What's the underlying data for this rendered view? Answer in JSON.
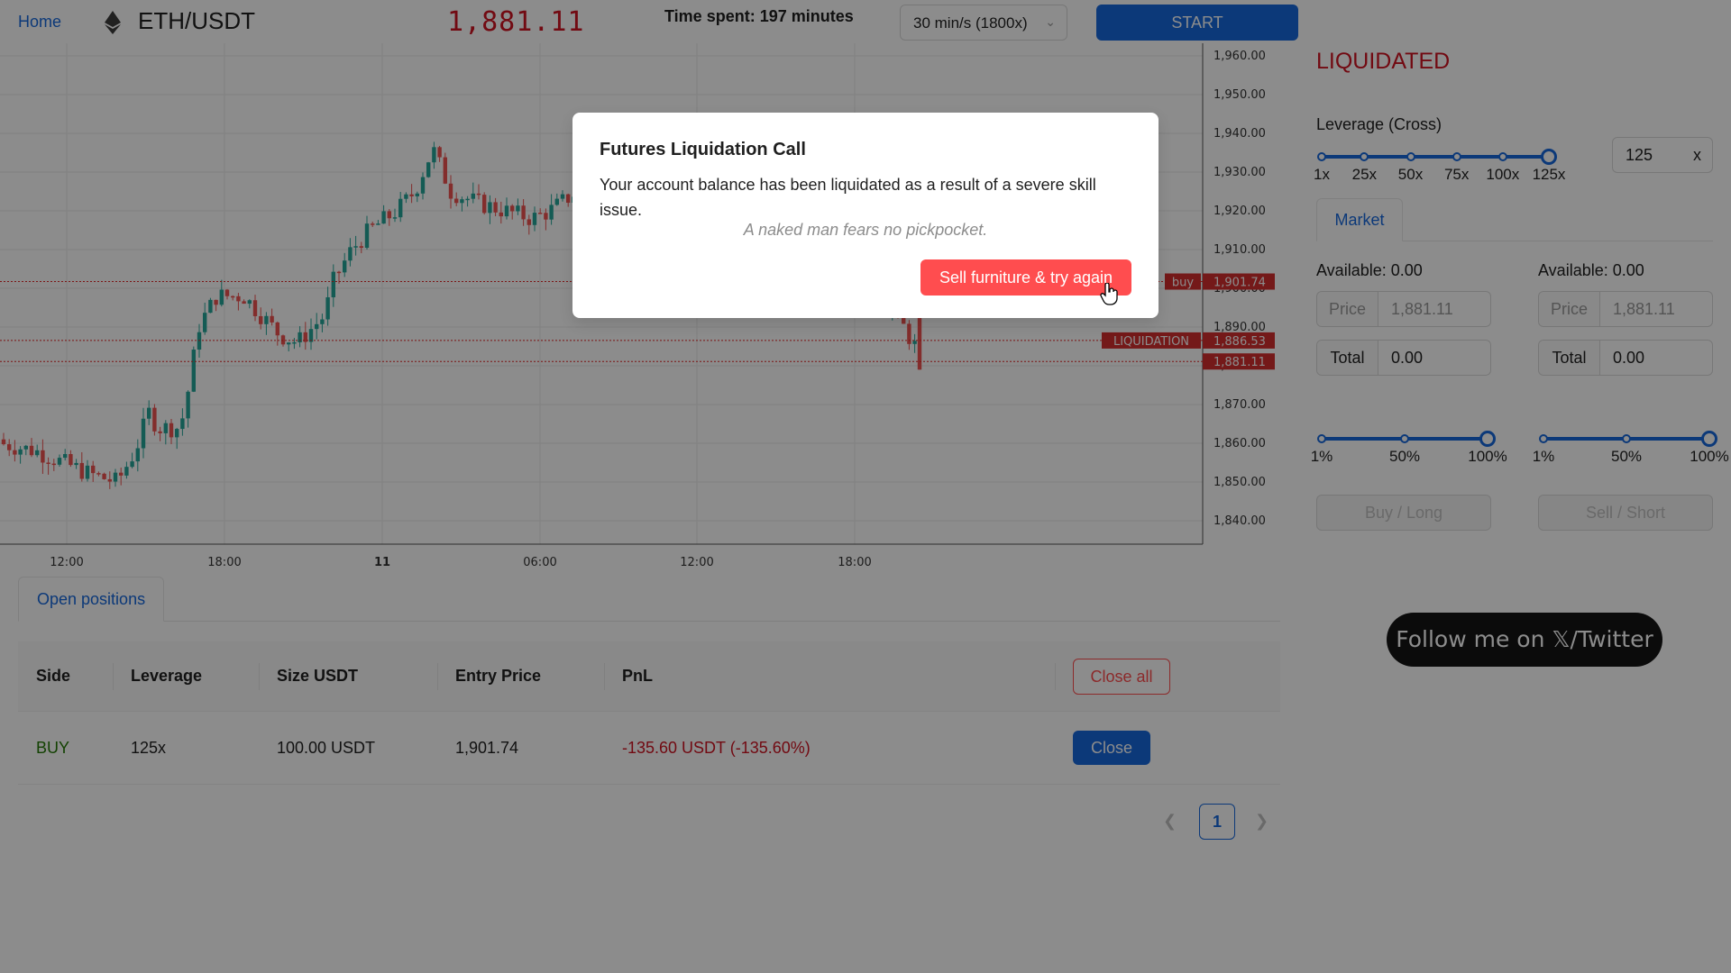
{
  "topbar": {
    "home_label": "Home",
    "pair": "ETH/USDT",
    "price": "1,881.11",
    "time_spent_label": "Time spent:",
    "time_spent_value": "197 minutes",
    "speed_select": "30 min/s (1800x)",
    "start_label": "START"
  },
  "chart_data": {
    "type": "candlestick",
    "y_ticks": [
      "1,960.00",
      "1,950.00",
      "1,940.00",
      "1,930.00",
      "1,920.00",
      "1,910.00",
      "1,900.00",
      "1,890.00",
      "1,880.00",
      "1,870.00",
      "1,860.00",
      "1,850.00",
      "1,840.00"
    ],
    "x_ticks": [
      "12:00",
      "18:00",
      "11",
      "06:00",
      "12:00",
      "18:00"
    ],
    "ylim": [
      1835,
      1962
    ],
    "price_lines": [
      {
        "label": "buy",
        "value": 1901.74,
        "value_label": "1,901.74"
      },
      {
        "label": "LIQUIDATION",
        "value": 1886.53,
        "value_label": "1,886.53"
      },
      {
        "label": "",
        "value": 1881.11,
        "value_label": "1,881.11"
      }
    ],
    "colors": {
      "up": "#26a69a",
      "down": "#ef5350",
      "grid": "#ececec",
      "line_red": "#e02424",
      "label_bg": "#d32f2f"
    }
  },
  "positions": {
    "tab_label": "Open positions",
    "headers": {
      "side": "Side",
      "leverage": "Leverage",
      "size": "Size USDT",
      "entry": "Entry Price",
      "pnl": "PnL"
    },
    "close_all_label": "Close all",
    "rows": [
      {
        "side": "BUY",
        "leverage": "125x",
        "size": "100.00 USDT",
        "entry": "1,901.74",
        "pnl": "-135.60 USDT (-135.60%)",
        "close_label": "Close"
      }
    ],
    "page": "1"
  },
  "panel": {
    "status": "LIQUIDATED",
    "leverage_label": "Leverage (Cross)",
    "leverage_marks": [
      "1x",
      "25x",
      "50x",
      "75x",
      "100x",
      "125x"
    ],
    "leverage_value": "125",
    "leverage_suffix": "x",
    "leverage_level": 1.0,
    "market_tab": "Market",
    "buy": {
      "available": "Available: 0.00",
      "price_addon": "Price",
      "price": "1,881.11",
      "total_addon": "Total",
      "total": "0.00",
      "pct_marks": [
        "1%",
        "50%",
        "100%"
      ],
      "pct_level": 1.0,
      "action": "Buy / Long"
    },
    "sell": {
      "available": "Available: 0.00",
      "price_addon": "Price",
      "price": "1,881.11",
      "total_addon": "Total",
      "total": "0.00",
      "pct_marks": [
        "1%",
        "50%",
        "100%"
      ],
      "pct_level": 1.0,
      "action": "Sell / Short"
    },
    "follow_label": "Follow me on 𝕏/Twitter"
  },
  "modal": {
    "title": "Futures Liquidation Call",
    "body": "Your account balance has been liquidated as a result of a severe skill issue.",
    "quote": "A naked man fears no pickpocket.",
    "button": "Sell furniture & try again"
  }
}
